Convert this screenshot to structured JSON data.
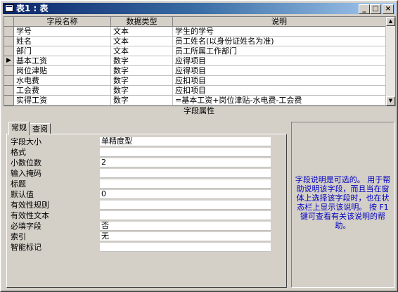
{
  "window": {
    "title": "表1 : 表"
  },
  "grid": {
    "headers": [
      "字段名称",
      "数据类型",
      "说明"
    ],
    "rows": [
      {
        "name": "学号",
        "type": "文本",
        "desc": "学生的学号"
      },
      {
        "name": "姓名",
        "type": "文本",
        "desc": "员工姓名(以身份证姓名为准)"
      },
      {
        "name": "部门",
        "type": "文本",
        "desc": "员工所属工作部门"
      },
      {
        "name": "基本工资",
        "type": "数字",
        "desc": "应得项目"
      },
      {
        "name": "岗位津贴",
        "type": "数字",
        "desc": "应得项目"
      },
      {
        "name": "水电费",
        "type": "数字",
        "desc": "应扣项目"
      },
      {
        "name": "工会费",
        "type": "数字",
        "desc": "应扣项目"
      },
      {
        "name": "实得工资",
        "type": "数字",
        "desc": "=基本工资+岗位津贴-水电费-工会费"
      }
    ],
    "current_row_marker": "▶"
  },
  "section_label": "字段属性",
  "tabs": [
    "常规",
    "查阅"
  ],
  "properties": [
    {
      "label": "字段大小",
      "value": "单精度型"
    },
    {
      "label": "格式",
      "value": ""
    },
    {
      "label": "小数位数",
      "value": "2"
    },
    {
      "label": "输入掩码",
      "value": ""
    },
    {
      "label": "标题",
      "value": ""
    },
    {
      "label": "默认值",
      "value": "0"
    },
    {
      "label": "有效性规则",
      "value": ""
    },
    {
      "label": "有效性文本",
      "value": ""
    },
    {
      "label": "必填字段",
      "value": "否"
    },
    {
      "label": "索引",
      "value": "无"
    },
    {
      "label": "智能标记",
      "value": ""
    }
  ],
  "help_text": "字段说明是可选的。 用于帮助说明该字段，而且当在窗体上选择该字段时，也在状态栏上显示该说明。 按 F1 键可查看有关该说明的帮助。",
  "controls": {
    "minimize": "_",
    "maximize": "□",
    "close": "×",
    "scroll_up": "▲",
    "scroll_down": "▼"
  },
  "colors": {
    "title_start": "#0a246a",
    "title_end": "#a6caf0",
    "help_text": "#0000c0",
    "face": "#d4d0c8"
  }
}
